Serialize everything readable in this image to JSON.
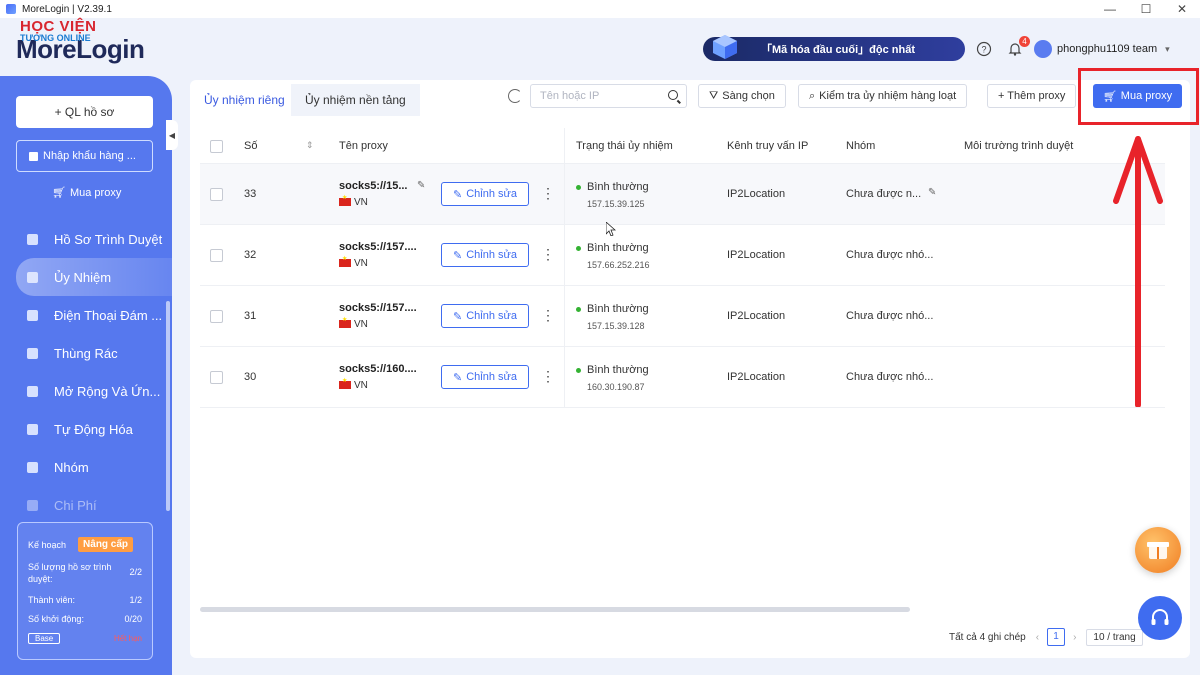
{
  "window": {
    "title": "MoreLogin | V2.39.1",
    "controls": [
      "—",
      "☐",
      "✕"
    ]
  },
  "watermark": {
    "line1": "HỌC VIỆN",
    "line2": "TƯƠNG ONLINE"
  },
  "header": {
    "brand": "MoreLogin",
    "promo": "「Mã hóa đầu cuối」độc nhất",
    "notification_count": "4",
    "team": "phongphu1109 team"
  },
  "sidebar": {
    "ql_button": "+ QL hồ sơ",
    "import_button": "Nhập khẩu hàng ...",
    "buy_proxy": "Mua proxy",
    "items": [
      {
        "label": "Hồ Sơ Trình Duyệt",
        "icon": "browser-icon"
      },
      {
        "label": "Ủy Nhiệm",
        "icon": "proxy-icon",
        "active": true
      },
      {
        "label": "Điện Thoại Đám ...",
        "icon": "phone-icon"
      },
      {
        "label": "Thùng Rác",
        "icon": "trash-icon"
      },
      {
        "label": "Mở Rộng Và Ứn...",
        "icon": "extension-icon"
      },
      {
        "label": "Tự Động Hóa",
        "icon": "automation-icon"
      },
      {
        "label": "Nhóm",
        "icon": "group-icon"
      },
      {
        "label": "Chi Phí",
        "icon": "cost-icon"
      }
    ],
    "plan": {
      "label": "Kế hoạch",
      "upgrade": "Nâng cấp",
      "rows": [
        {
          "label": "Số lượng hồ sơ trình duyệt:",
          "value": "2/2"
        },
        {
          "label": "Thành viên:",
          "value": "1/2"
        },
        {
          "label": "Số khởi động:",
          "value": "0/20"
        }
      ],
      "base": "Base",
      "expired": "Hết hạn"
    }
  },
  "main": {
    "tabs": [
      "Ủy nhiệm riêng",
      "Ủy nhiệm nền tảng"
    ],
    "search_placeholder": "Tên hoặc IP",
    "toolbar": {
      "filter": "Sàng chọn",
      "batch_check": "Kiểm tra ủy nhiệm hàng loạt",
      "add_proxy": "+ Thêm proxy",
      "buy_proxy": "Mua proxy"
    },
    "columns": [
      "Số",
      "Tên proxy",
      "Trạng thái ủy nhiệm",
      "Kênh truy vấn IP",
      "Nhóm",
      "Môi trường trình duyệt"
    ],
    "edit_label": "Chỉnh sửa",
    "rows": [
      {
        "no": "33",
        "name": "socks5://15...",
        "country": "VN",
        "status": "Bình thường",
        "ip": "157.15.39.125",
        "channel": "IP2Location",
        "group": "Chưa được n..."
      },
      {
        "no": "32",
        "name": "socks5://157....",
        "country": "VN",
        "status": "Bình thường",
        "ip": "157.66.252.216",
        "channel": "IP2Location",
        "group": "Chưa được nhó..."
      },
      {
        "no": "31",
        "name": "socks5://157....",
        "country": "VN",
        "status": "Bình thường",
        "ip": "157.15.39.128",
        "channel": "IP2Location",
        "group": "Chưa được nhó..."
      },
      {
        "no": "30",
        "name": "socks5://160....",
        "country": "VN",
        "status": "Bình thường",
        "ip": "160.30.190.87",
        "channel": "IP2Location",
        "group": "Chưa được nhó..."
      }
    ],
    "pager": {
      "total": "Tất cả 4 ghi chép",
      "page": "1",
      "size": "10 / trang"
    }
  },
  "colors": {
    "primary": "#3f6cf0",
    "sidebar": "#5678ee",
    "highlight": "#e8232a",
    "status_ok": "#34b233"
  }
}
